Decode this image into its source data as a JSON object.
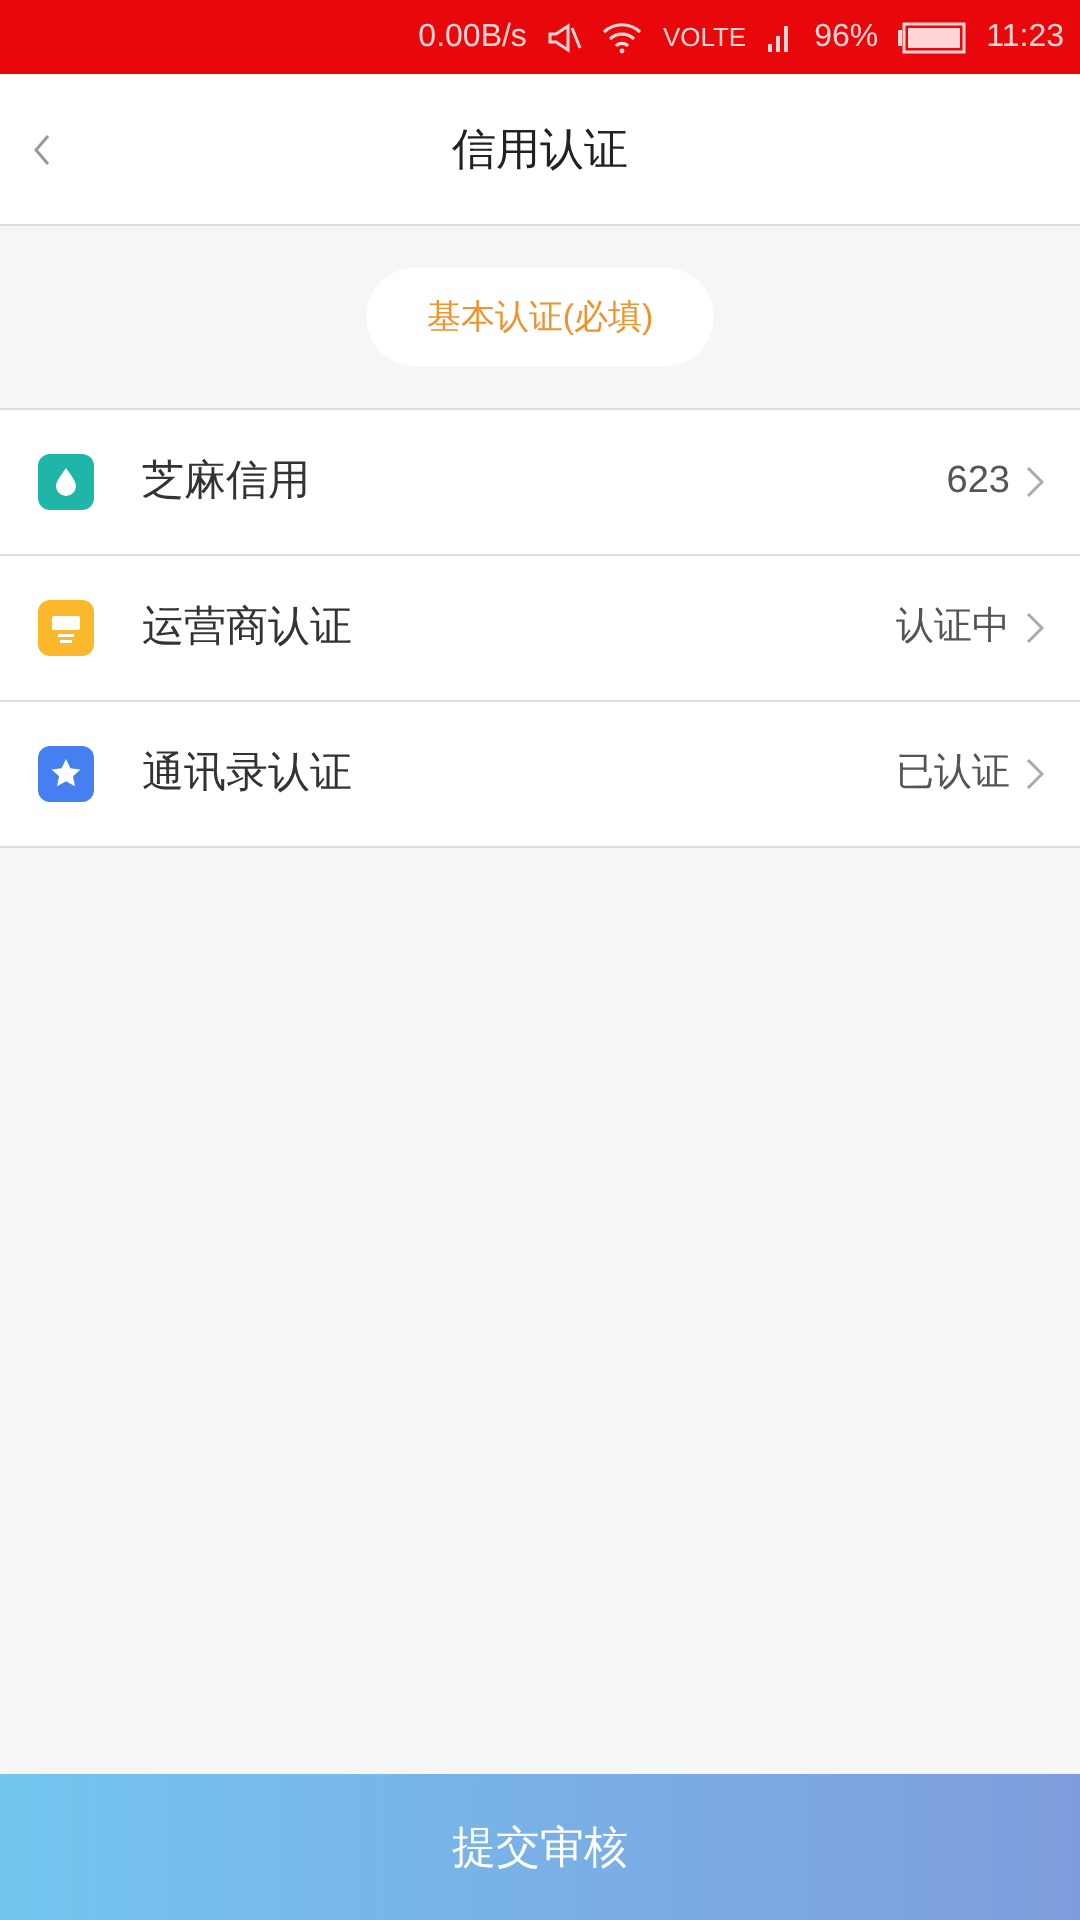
{
  "status_bar": {
    "speed": "0.00B/s",
    "network": "VOLTE",
    "battery": "96%",
    "time": "11:23"
  },
  "header": {
    "title": "信用认证"
  },
  "section": {
    "label": "基本认证(必填)"
  },
  "rows": [
    {
      "kind": "drop",
      "color": "#1fb5a8",
      "label": "芝麻信用",
      "value": "623"
    },
    {
      "kind": "screen",
      "color": "#fbb82b",
      "label": "运营商认证",
      "value": "认证中"
    },
    {
      "kind": "star",
      "color": "#4680f0",
      "label": "通讯录认证",
      "value": "已认证"
    }
  ],
  "submit": {
    "label": "提交审核"
  }
}
